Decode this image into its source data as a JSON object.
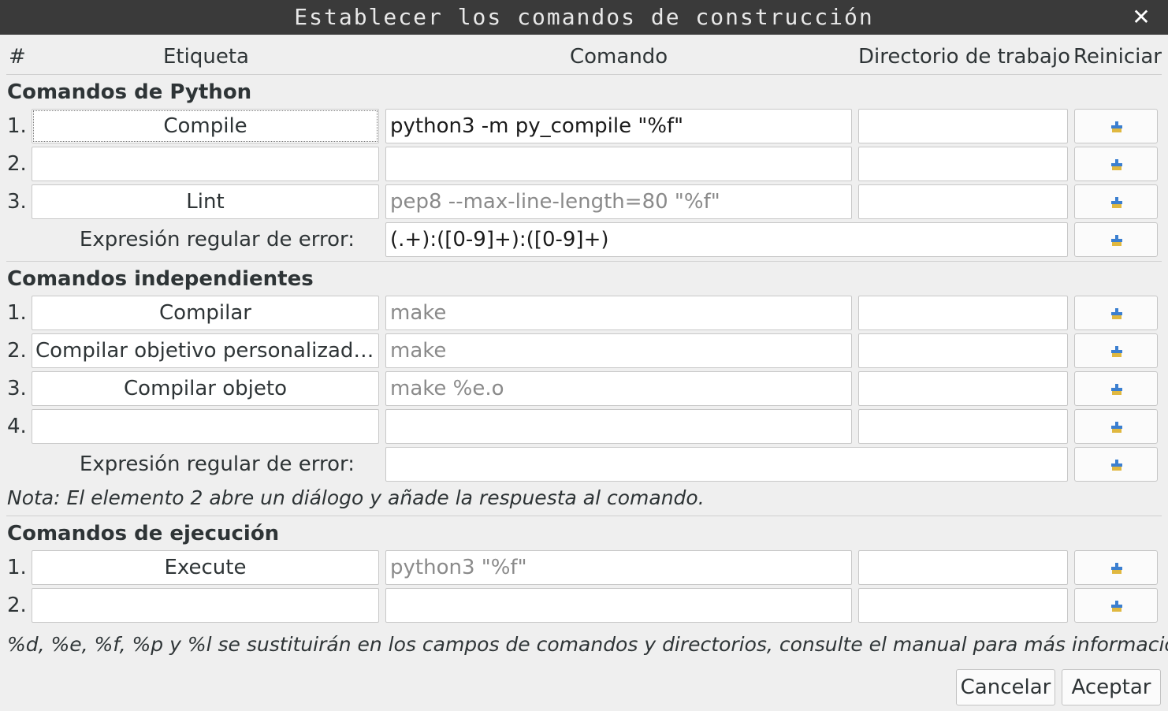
{
  "window": {
    "title": "Establecer los comandos de construcción",
    "close_glyph": "✕"
  },
  "headers": {
    "num": "#",
    "label": "Etiqueta",
    "command": "Comando",
    "workdir": "Directorio de trabajo",
    "reset": "Reiniciar"
  },
  "python": {
    "title": "Comandos de Python",
    "rows": [
      {
        "num": "1.",
        "label": "Compile",
        "command": "python3 -m py_compile \"%f\"",
        "command_is_placeholder": false,
        "workdir": ""
      },
      {
        "num": "2.",
        "label": "",
        "command": "",
        "command_is_placeholder": false,
        "workdir": ""
      },
      {
        "num": "3.",
        "label": "Lint",
        "command": "pep8 --max-line-length=80 \"%f\"",
        "command_is_placeholder": true,
        "workdir": ""
      }
    ],
    "regex_label": "Expresión regular de error:",
    "regex_value": "(.+):([0-9]+):([0-9]+)"
  },
  "independent": {
    "title": "Comandos independientes",
    "rows": [
      {
        "num": "1.",
        "label": "Compilar",
        "command": "make",
        "command_is_placeholder": true,
        "workdir": ""
      },
      {
        "num": "2.",
        "label": "Compilar objetivo personalizado...",
        "command": "make",
        "command_is_placeholder": true,
        "workdir": ""
      },
      {
        "num": "3.",
        "label": "Compilar objeto",
        "command": "make %e.o",
        "command_is_placeholder": true,
        "workdir": ""
      },
      {
        "num": "4.",
        "label": "",
        "command": "",
        "command_is_placeholder": false,
        "workdir": ""
      }
    ],
    "regex_label": "Expresión regular de error:",
    "regex_value": "",
    "note": "Nota: El elemento 2 abre un diálogo y añade la respuesta al comando."
  },
  "execute": {
    "title": "Comandos de ejecución",
    "rows": [
      {
        "num": "1.",
        "label": "Execute",
        "command": "python3 \"%f\"",
        "command_is_placeholder": true,
        "workdir": ""
      },
      {
        "num": "2.",
        "label": "",
        "command": "",
        "command_is_placeholder": false,
        "workdir": ""
      }
    ]
  },
  "footer_note": "%d, %e, %f, %p y %l se sustituirán en los campos de comandos y directorios, consulte el manual para más información.",
  "buttons": {
    "cancel": "Cancelar",
    "accept": "Aceptar"
  },
  "icons": {
    "reset": "edit-clear-icon"
  },
  "colors": {
    "titlebar": "#3a3a3a",
    "background": "#efefef",
    "placeholder_text": "#8a8a8a",
    "icon_blue": "#3b7fd0",
    "icon_yellow": "#e0b840"
  }
}
